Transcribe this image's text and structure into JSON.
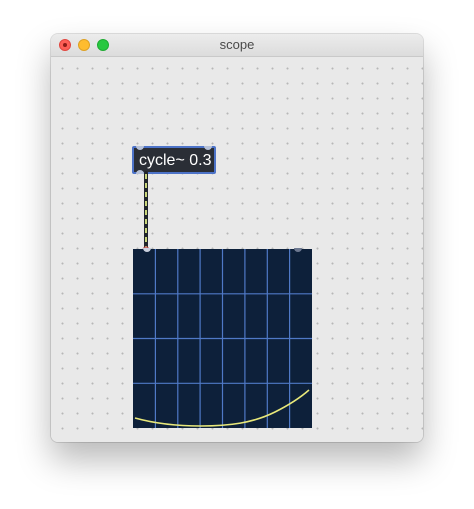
{
  "window": {
    "title": "scope"
  },
  "patch": {
    "object": {
      "label": "cycle~ 0.3"
    }
  },
  "colors": {
    "canvas": "#e9e9e9",
    "object_bg": "#2a2e36",
    "object_border": "#4d73c8",
    "scope_bg": "#0d203a",
    "scope_grid": "#4f79c6",
    "scope_trace": "#e8e87a",
    "patchcord": "#c9d67b"
  },
  "icons": {
    "close": "close-icon",
    "minimize": "minimize-icon",
    "zoom": "zoom-icon"
  }
}
